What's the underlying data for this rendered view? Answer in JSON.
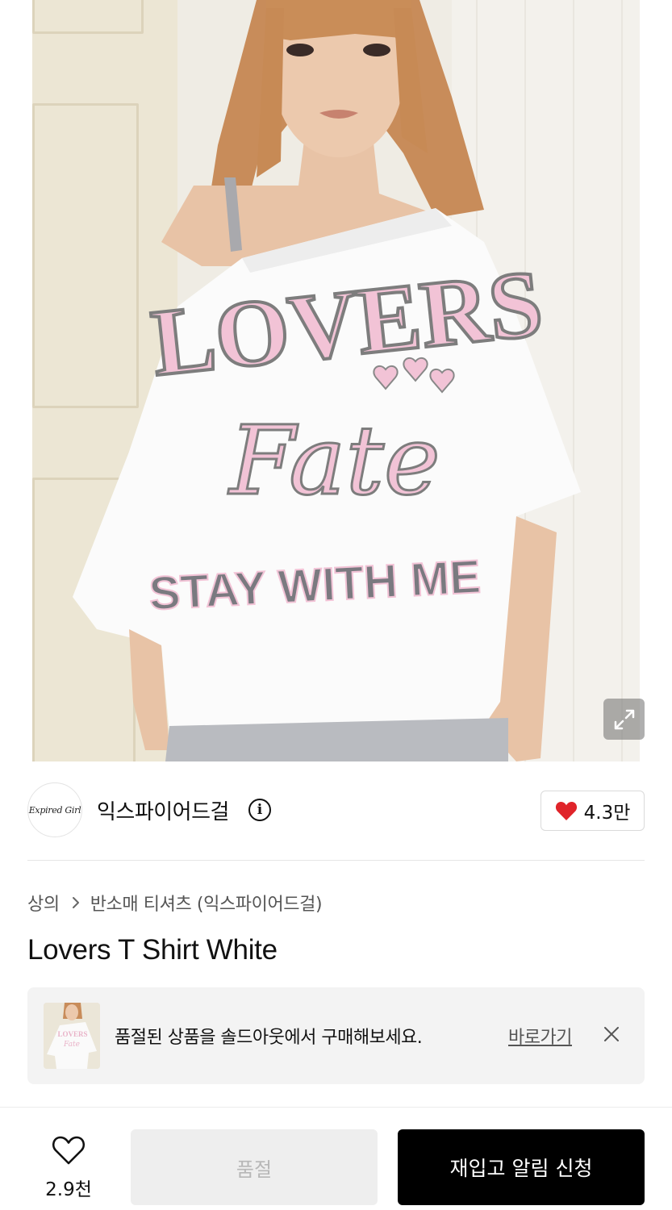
{
  "product_image": {
    "alt": "Lovers T Shirt White",
    "shirt_print": {
      "line1": "LOVERS",
      "line2": "Fate",
      "line3": "STAY WITH ME"
    },
    "expand_icon": "expand-arrows-icon"
  },
  "brand": {
    "logo_text": "Expired Girl",
    "name": "익스파이어드걸",
    "info_icon": "info-icon",
    "like_count": "4.3만",
    "like_color": "#e0242a"
  },
  "breadcrumb": {
    "category": "상의",
    "subcategory": "반소매 티셔츠 (익스파이어드걸)"
  },
  "product": {
    "title": "Lovers T Shirt White"
  },
  "banner": {
    "text": "품절된 상품을 솔드아웃에서 구매해보세요.",
    "link": "바로가기",
    "close_icon": "close-icon"
  },
  "bottom_bar": {
    "wish_icon": "heart-outline-icon",
    "wish_count": "2.9천",
    "soldout_label": "품절",
    "restock_label": "재입고 알림 신청"
  }
}
